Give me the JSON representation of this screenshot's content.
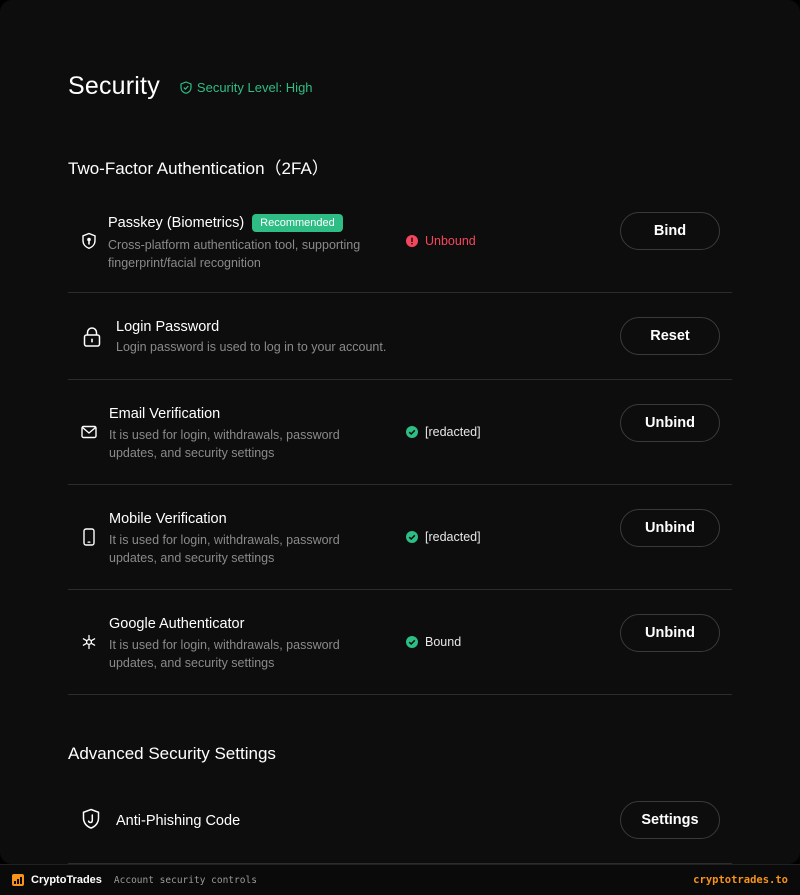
{
  "header": {
    "title": "Security",
    "level_text": "Security Level: High"
  },
  "sections": {
    "twofa_title": "Two-Factor Authentication（2FA）",
    "advanced_title": "Advanced Security Settings"
  },
  "twofa_items": [
    {
      "title": "Passkey (Biometrics)",
      "badge": "Recommended",
      "desc_line1": "Cross-platform authentication tool, supporting",
      "desc_line2": "fingerprint/facial recognition",
      "status": "Unbound",
      "action": "Bind",
      "icon": "passkey-shield-icon"
    },
    {
      "title": "Login Password",
      "desc_line1": "Login password is used to log in to your account.",
      "action": "Reset",
      "icon": "lock-icon"
    },
    {
      "title": "Email Verification",
      "desc_line1": "It is used for login, withdrawals, password",
      "desc_line2": "updates, and security settings",
      "status": "[redacted]",
      "action": "Unbind",
      "icon": "mail-icon"
    },
    {
      "title": "Mobile Verification",
      "desc_line1": "It is used for login, withdrawals, password",
      "desc_line2": "updates, and security settings",
      "status": "[redacted]",
      "action": "Unbind",
      "icon": "mobile-icon"
    },
    {
      "title": "Google Authenticator",
      "desc_line1": "It is used for login, withdrawals, password",
      "desc_line2": "updates, and security settings",
      "status": "Bound",
      "action": "Unbind",
      "icon": "authenticator-icon"
    }
  ],
  "advanced_items": [
    {
      "title": "Anti-Phishing Code",
      "action": "Settings",
      "icon": "anti-phishing-shield-icon"
    }
  ],
  "footer": {
    "brand": "CryptoTrades",
    "subtitle": "Account security controls",
    "url": "cryptotrades.to"
  },
  "colors": {
    "accent_green": "#2ebd85",
    "error_red": "#f6465d",
    "brand_orange": "#f7931a",
    "background": "#0d0d0d"
  }
}
